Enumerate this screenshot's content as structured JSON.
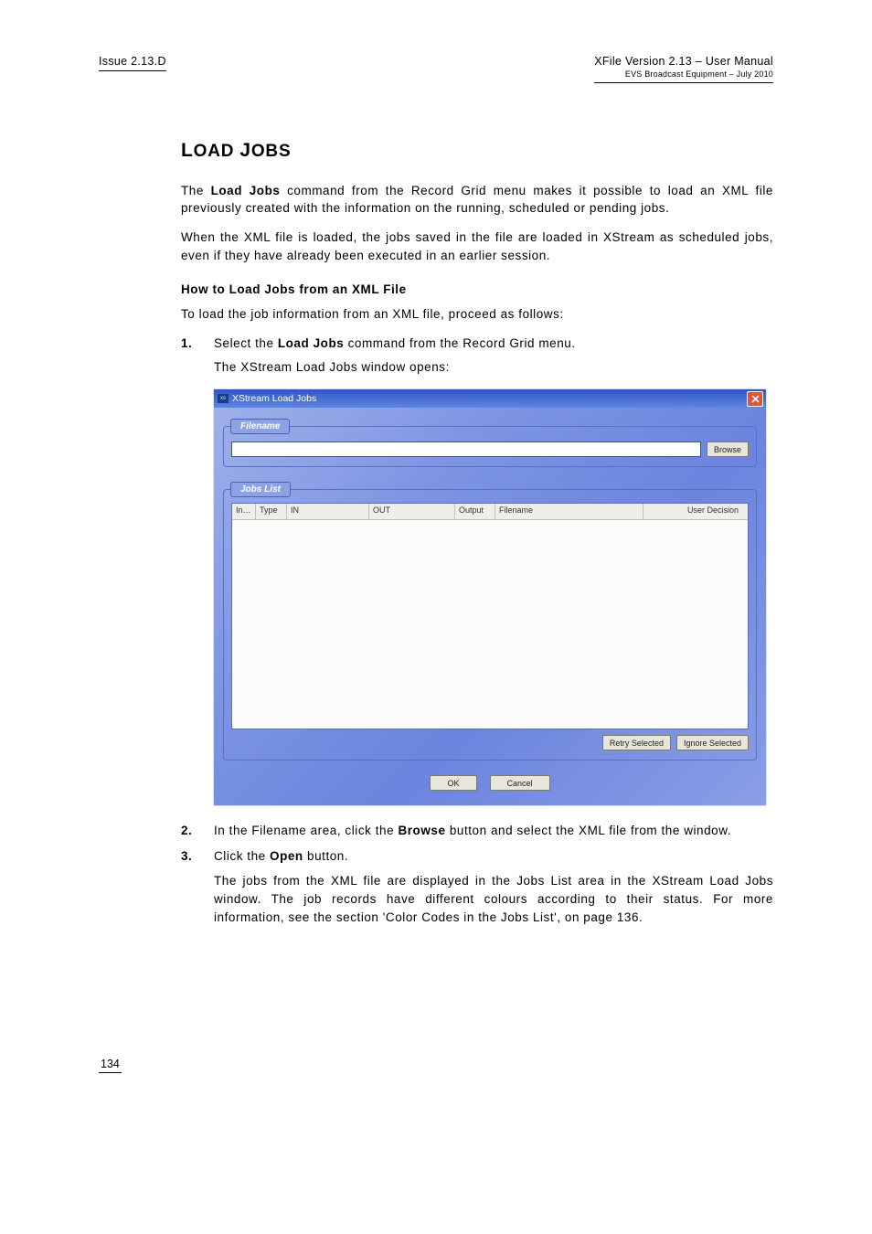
{
  "header": {
    "issue": "Issue 2.13.D",
    "title": "XFile Version 2.13 – User Manual",
    "sub": "EVS Broadcast Equipment – July 2010"
  },
  "section_title_parts": {
    "l1": "L",
    "oad": "OAD",
    "sp": " ",
    "j": "J",
    "obs": "OBS"
  },
  "para1_a": "The ",
  "para1_b": "Load Jobs",
  "para1_c": " command from the Record Grid menu makes it possible to load an XML file previously created with the information on the running, scheduled or pending jobs.",
  "para2": "When the XML file is loaded, the jobs saved in the file are loaded in XStream as scheduled jobs, even if they have already been executed in an earlier session.",
  "subhead": "How to Load Jobs from an XML File",
  "intro": "To load the job information from an XML file, proceed as follows:",
  "step1_num": "1.",
  "step1_a": "Select the ",
  "step1_b": "Load Jobs",
  "step1_c": " command from the Record Grid menu.",
  "step1_sub": "The XStream Load Jobs window opens:",
  "dialog": {
    "title": "XStream Load Jobs",
    "filename_label": "Filename",
    "jobslist_label": "Jobs List",
    "browse": "Browse",
    "columns": {
      "index": "In…",
      "type": "Type",
      "in": "IN",
      "out": "OUT",
      "output": "Output",
      "filename": "Filename",
      "user_decision": "User Decision"
    },
    "retry": "Retry Selected",
    "ignore": "Ignore Selected",
    "ok": "OK",
    "cancel": "Cancel"
  },
  "step2_num": "2.",
  "step2_a": "In the Filename area, click the ",
  "step2_b": "Browse",
  "step2_c": " button and select the XML file from the window.",
  "step3_num": "3.",
  "step3_a": "Click the ",
  "step3_b": "Open",
  "step3_c": " button.",
  "step3_sub": "The jobs from the XML file are displayed in the Jobs List area in the XStream Load Jobs window. The job records have different colours according to their status. For more information, see the section 'Color Codes in the Jobs List', on page 136.",
  "page_number": "134"
}
